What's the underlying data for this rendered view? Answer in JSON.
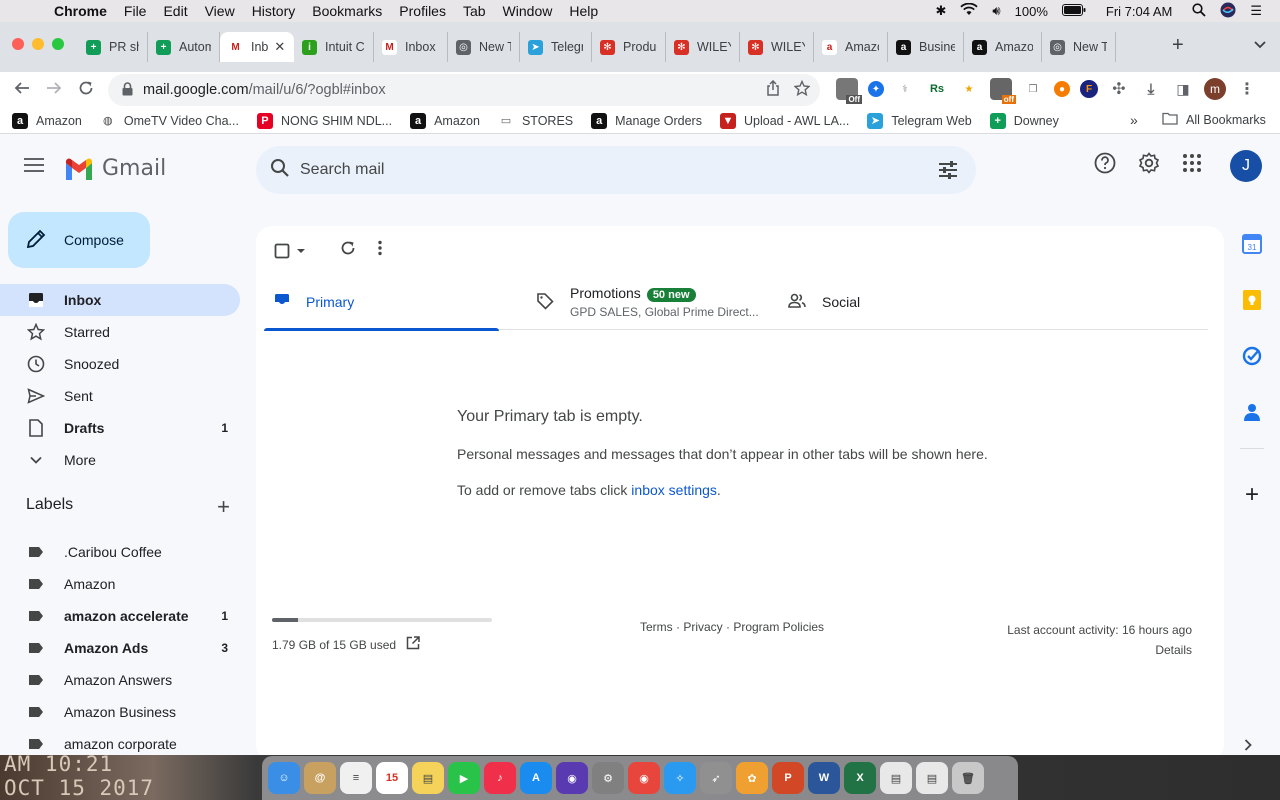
{
  "menubar": {
    "app": "Chrome",
    "items": [
      "File",
      "Edit",
      "View",
      "History",
      "Bookmarks",
      "Profiles",
      "Tab",
      "Window",
      "Help"
    ],
    "battery": "100%",
    "clock": "Fri 7:04 AM"
  },
  "tabs": [
    {
      "label": "PR she",
      "color": "#0f9d58",
      "glyph": "+"
    },
    {
      "label": "Autom",
      "color": "#0f9d58",
      "glyph": "+"
    },
    {
      "label": "Inb",
      "color": "#ffffff",
      "glyph": "M",
      "active": true
    },
    {
      "label": "Intuit C",
      "color": "#2ca01c",
      "glyph": "i"
    },
    {
      "label": "Inbox (",
      "color": "#ffffff",
      "glyph": "M"
    },
    {
      "label": "New T",
      "color": "#5f6368",
      "glyph": "◎"
    },
    {
      "label": "Telegr",
      "color": "#2aa1da",
      "glyph": "➤"
    },
    {
      "label": "Produc",
      "color": "#d93025",
      "glyph": "✻"
    },
    {
      "label": "WILEY",
      "color": "#d93025",
      "glyph": "✻"
    },
    {
      "label": "WILEY",
      "color": "#d93025",
      "glyph": "✻"
    },
    {
      "label": "Amazo",
      "color": "#ffffff",
      "glyph": "a"
    },
    {
      "label": "Busine",
      "color": "#111111",
      "glyph": "a"
    },
    {
      "label": "Amazo",
      "color": "#111111",
      "glyph": "a"
    },
    {
      "label": "New T",
      "color": "#5f6368",
      "glyph": "◎"
    }
  ],
  "omnibox": {
    "host": "mail.google.com",
    "path": "/mail/u/6/?ogbl#inbox"
  },
  "extensions": {
    "off_badge_1": "Off",
    "rs": "Rs",
    "off_badge_2": "off",
    "f": "F",
    "profile": "m"
  },
  "bookmarks": [
    {
      "label": "Amazon",
      "glyph": "a",
      "color": "#111111"
    },
    {
      "label": "OmeTV Video Cha...",
      "glyph": "◍",
      "color": "#444444"
    },
    {
      "label": "NONG SHIM NDL...",
      "glyph": "P",
      "color": "#e60023"
    },
    {
      "label": "Amazon",
      "glyph": "a",
      "color": "#111111"
    },
    {
      "label": "STORES",
      "glyph": "▭",
      "color": "#5f6368"
    },
    {
      "label": "Manage Orders",
      "glyph": "a",
      "color": "#111111"
    },
    {
      "label": "Upload - AWL LA...",
      "glyph": "▼",
      "color": "#c5221f"
    },
    {
      "label": "Telegram Web",
      "glyph": "➤",
      "color": "#2aa1da"
    },
    {
      "label": "Downey",
      "glyph": "+",
      "color": "#0f9d58"
    }
  ],
  "bookmarks_more": "»",
  "all_bookmarks": "All Bookmarks",
  "gmail": {
    "wordmark": "Gmail",
    "search_placeholder": "Search mail",
    "avatar": "J",
    "compose": "Compose",
    "nav": [
      {
        "key": "inbox",
        "label": "Inbox",
        "count": "",
        "active": true
      },
      {
        "key": "starred",
        "label": "Starred",
        "count": ""
      },
      {
        "key": "snoozed",
        "label": "Snoozed",
        "count": ""
      },
      {
        "key": "sent",
        "label": "Sent",
        "count": ""
      },
      {
        "key": "drafts",
        "label": "Drafts",
        "count": "1",
        "bold": true
      },
      {
        "key": "more",
        "label": "More",
        "count": ""
      }
    ],
    "labels_title": "Labels",
    "labels": [
      {
        "label": ".Caribou Coffee",
        "count": ""
      },
      {
        "label": "Amazon",
        "count": ""
      },
      {
        "label": "amazon accelerate",
        "count": "1",
        "bold": true
      },
      {
        "label": "Amazon Ads",
        "count": "3",
        "bold": true
      },
      {
        "label": "Amazon Answers",
        "count": ""
      },
      {
        "label": "Amazon Business",
        "count": ""
      },
      {
        "label": "amazon corporate",
        "count": ""
      }
    ],
    "category_tabs": {
      "primary": "Primary",
      "promotions": "Promotions",
      "promotions_badge": "50 new",
      "promotions_sub": "GPD SALES, Global Prime Direct...",
      "social": "Social"
    },
    "empty": {
      "title": "Your Primary tab is empty.",
      "line": "Personal messages and messages that don’t appear in other tabs will be shown here.",
      "settings_prefix": "To add or remove tabs click ",
      "settings_link": "inbox settings",
      "settings_suffix": "."
    },
    "storage": {
      "text": "1.79 GB of 15 GB used",
      "used_fraction": 0.119
    },
    "footer": "Terms · Privacy · Program Policies",
    "activity": "Last account activity: 16 hours ago",
    "details": "Details"
  },
  "desktop_stamp": {
    "line1": "AM 10:21",
    "line2": "OCT 15 2017"
  },
  "dock": [
    {
      "name": "finder",
      "color": "#3a8ee6",
      "glyph": "☺"
    },
    {
      "name": "contacts",
      "color": "#c8a060",
      "glyph": "@"
    },
    {
      "name": "reminders",
      "color": "#f0f0f0",
      "glyph": "≡"
    },
    {
      "name": "calendar",
      "color": "#ffffff",
      "glyph": "15"
    },
    {
      "name": "notes",
      "color": "#f5d35a",
      "glyph": "▤"
    },
    {
      "name": "facetime",
      "color": "#2ac34a",
      "glyph": "▶"
    },
    {
      "name": "music",
      "color": "#f0304a",
      "glyph": "♪"
    },
    {
      "name": "app-store",
      "color": "#1a8cf0",
      "glyph": "A"
    },
    {
      "name": "siri",
      "color": "#5a3ab0",
      "glyph": "◉"
    },
    {
      "name": "system-preferences",
      "color": "#808080",
      "glyph": "⚙"
    },
    {
      "name": "chrome",
      "color": "#e8453c",
      "glyph": "◉"
    },
    {
      "name": "safari",
      "color": "#2a9af0",
      "glyph": "✧"
    },
    {
      "name": "launchpad",
      "color": "#909090",
      "glyph": "➶"
    },
    {
      "name": "photos",
      "color": "#f0a030",
      "glyph": "✿"
    },
    {
      "name": "powerpoint",
      "color": "#d24726",
      "glyph": "P"
    },
    {
      "name": "word",
      "color": "#2b579a",
      "glyph": "W"
    },
    {
      "name": "excel",
      "color": "#217346",
      "glyph": "X"
    },
    {
      "name": "document-1",
      "color": "#e8e8e8",
      "glyph": "▤"
    },
    {
      "name": "document-2",
      "color": "#e8e8e8",
      "glyph": "▤"
    },
    {
      "name": "trash",
      "color": "#c8c8c8",
      "glyph": "🗑"
    }
  ]
}
